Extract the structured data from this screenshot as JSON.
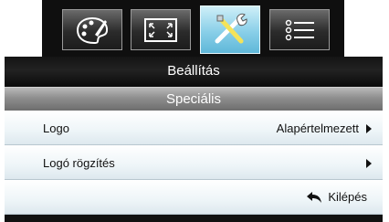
{
  "tabs": [
    {
      "id": "image",
      "icon": "palette-icon",
      "active": false
    },
    {
      "id": "display",
      "icon": "fullscreen-icon",
      "active": false
    },
    {
      "id": "setup",
      "icon": "tools-icon",
      "active": true
    },
    {
      "id": "options",
      "icon": "list-icon",
      "active": false
    }
  ],
  "menu": {
    "title": "Beállítás",
    "subtitle": "Speciális",
    "items": [
      {
        "label": "Logo",
        "value": "Alapértelmezett",
        "has_submenu": true
      },
      {
        "label": "Logó rögzítés",
        "value": "",
        "has_submenu": true
      }
    ],
    "exit_label": "Kilépés",
    "exit_icon": "return-arrow-icon"
  },
  "colors": {
    "accent": "#89cfe8",
    "header_bg": "#1a1a1a",
    "subheader_bg": "#8e8e8e"
  }
}
